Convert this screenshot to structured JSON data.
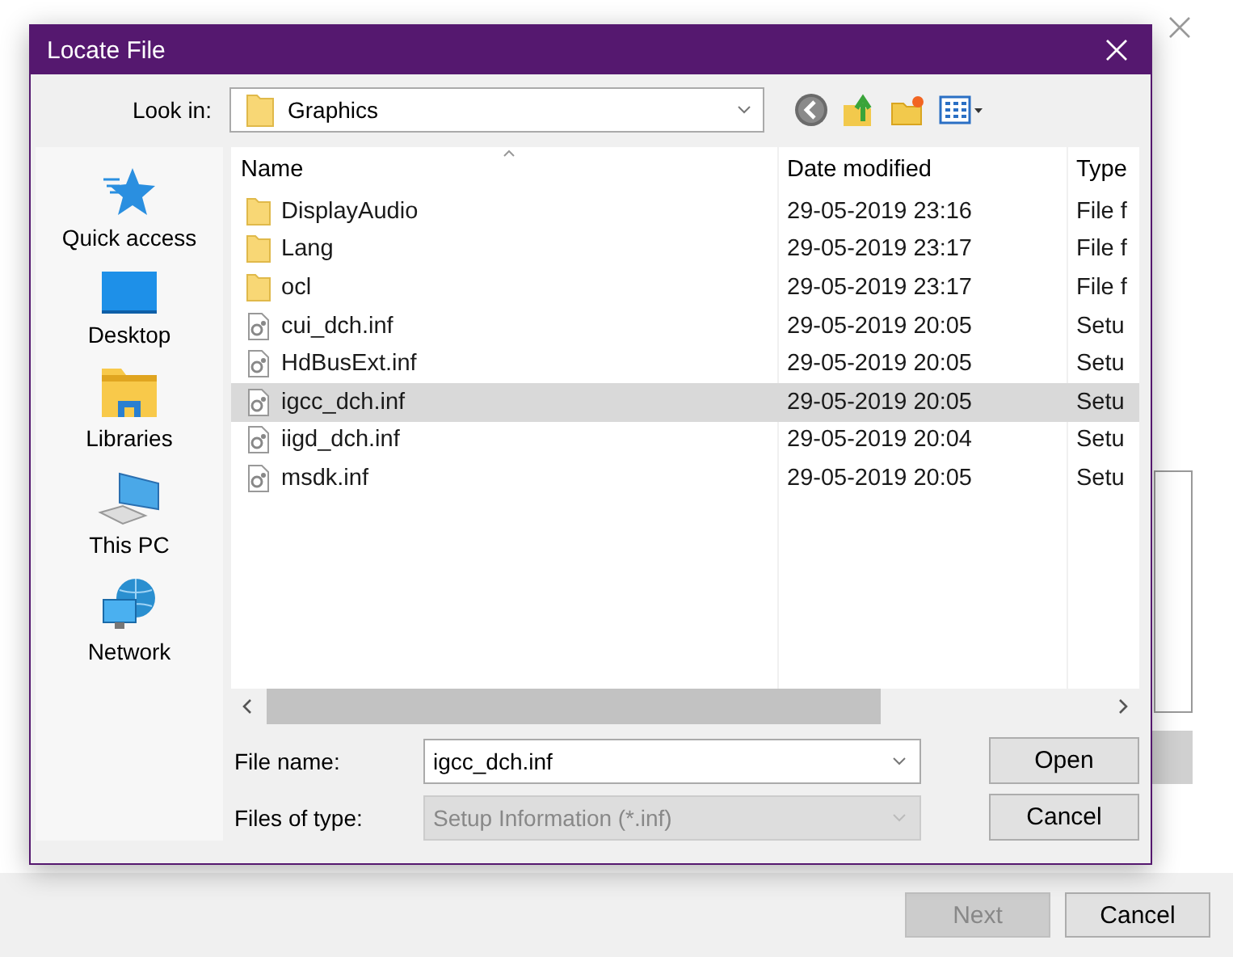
{
  "wizard": {
    "buttons": [
      {
        "label": "Next",
        "disabled": true
      },
      {
        "label": "Cancel",
        "disabled": false
      }
    ]
  },
  "dialog": {
    "title": "Locate File",
    "look_in": {
      "label": "Look in:",
      "value": "Graphics"
    },
    "places": [
      {
        "label": "Quick access",
        "kind": "star"
      },
      {
        "label": "Desktop",
        "kind": "desktop"
      },
      {
        "label": "Libraries",
        "kind": "libraries"
      },
      {
        "label": "This PC",
        "kind": "pc"
      },
      {
        "label": "Network",
        "kind": "network"
      }
    ],
    "columns": [
      "Name",
      "Date modified",
      "Type"
    ],
    "files": [
      {
        "name": "DisplayAudio",
        "date": "29-05-2019 23:16",
        "type": "File f",
        "kind": "folder",
        "selected": false
      },
      {
        "name": "Lang",
        "date": "29-05-2019 23:17",
        "type": "File f",
        "kind": "folder",
        "selected": false
      },
      {
        "name": "ocl",
        "date": "29-05-2019 23:17",
        "type": "File f",
        "kind": "folder",
        "selected": false
      },
      {
        "name": "cui_dch.inf",
        "date": "29-05-2019 20:05",
        "type": "Setu",
        "kind": "file",
        "selected": false
      },
      {
        "name": "HdBusExt.inf",
        "date": "29-05-2019 20:05",
        "type": "Setu",
        "kind": "file",
        "selected": false
      },
      {
        "name": "igcc_dch.inf",
        "date": "29-05-2019 20:05",
        "type": "Setu",
        "kind": "file",
        "selected": true
      },
      {
        "name": "iigd_dch.inf",
        "date": "29-05-2019 20:04",
        "type": "Setu",
        "kind": "file",
        "selected": false
      },
      {
        "name": "msdk.inf",
        "date": "29-05-2019 20:05",
        "type": "Setu",
        "kind": "file",
        "selected": false
      }
    ],
    "file_name": {
      "label": "File name:",
      "value": "igcc_dch.inf"
    },
    "file_type": {
      "label": "Files of type:",
      "value": "Setup Information (*.inf)",
      "disabled": true
    },
    "buttons": [
      "Open",
      "Cancel"
    ]
  }
}
